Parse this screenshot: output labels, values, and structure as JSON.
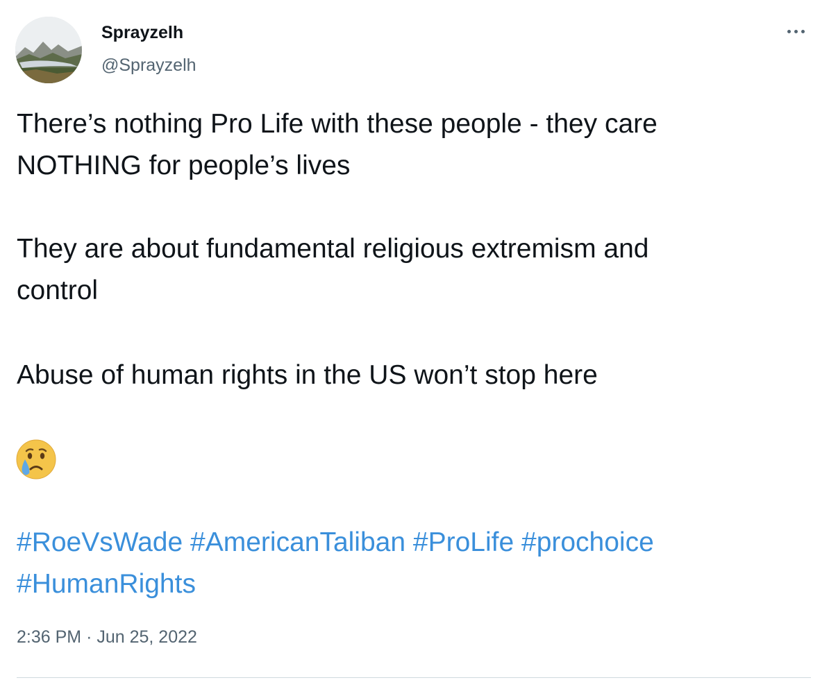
{
  "author": {
    "name": "Sprayzelh",
    "handle": "@Sprayzelh",
    "avatar_icon": "landscape-avatar"
  },
  "menu_icon": "more-options-icon",
  "body": {
    "line1": "There’s nothing Pro Life with these people - they care",
    "line2": "NOTHING for people’s lives",
    "line3": "They are about fundamental religious extremism and",
    "line4": "control",
    "line5": "Abuse of human rights in the US won’t stop here",
    "emoji": "😢"
  },
  "hashtags": {
    "row1": [
      "#RoeVsWade",
      "#AmericanTaliban",
      "#ProLife",
      "#prochoice"
    ],
    "row2": [
      "#HumanRights"
    ]
  },
  "timestamp": {
    "time": "2:36 PM",
    "separator": "·",
    "date": "Jun 25, 2022"
  },
  "colors": {
    "link": "#3a8fdb",
    "secondary_text": "#536471",
    "primary_text": "#0f1419"
  }
}
